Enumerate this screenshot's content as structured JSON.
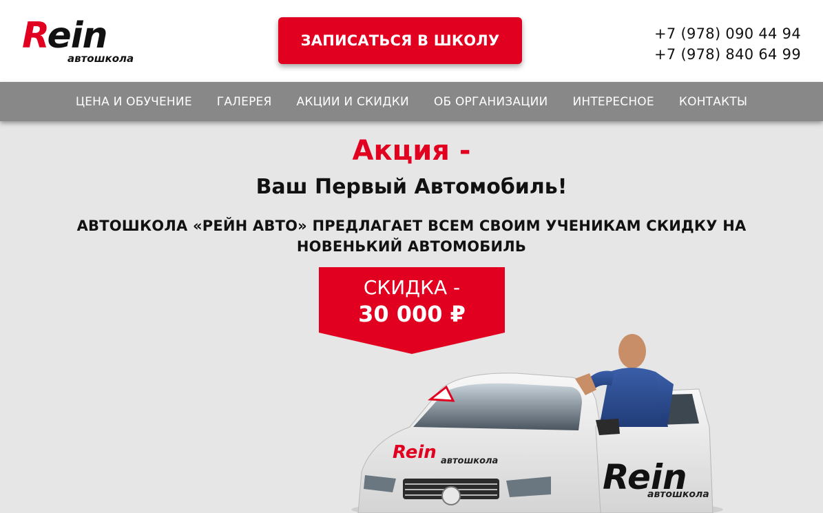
{
  "header": {
    "logo": {
      "brand": "Rein",
      "brand_first": "R",
      "brand_rest": "ein",
      "subtitle": "автошкола"
    },
    "cta_label": "ЗАПИСАТЬСЯ В ШКОЛУ",
    "phones": [
      "+7 (978) 090 44 94",
      "+7 (978) 840 64 99"
    ]
  },
  "nav": {
    "items": [
      {
        "label": "ЦЕНА И ОБУЧЕНИЕ"
      },
      {
        "label": "ГАЛЕРЕЯ"
      },
      {
        "label": "АКЦИИ И СКИДКИ"
      },
      {
        "label": "ОБ ОРГАНИЗАЦИИ"
      },
      {
        "label": "ИНТЕРЕСНОЕ"
      },
      {
        "label": "КОНТАКТЫ"
      }
    ]
  },
  "promo": {
    "title": "Акция -",
    "subtitle": "Ваш Первый Автомобиль!",
    "description": "АВТОШКОЛА «РЕЙН АВТО» ПРЕДЛАГАЕТ ВСЕМ СВОИМ УЧЕНИКАМ СКИДКУ НА НОВЕНЬКИЙ АВТОМОБИЛЬ",
    "discount_label": "СКИДКА -",
    "discount_value": "30 000 ₽"
  },
  "photo": {
    "car_logo_brand": "Rein",
    "car_logo_subtitle": "автошкола",
    "door_logo_brand": "Rein",
    "door_logo_subtitle": "автошкола"
  },
  "colors": {
    "accent": "#e1001f",
    "nav_bg": "#888888",
    "page_bg": "#e6e6e6",
    "header_bg": "#ffffff"
  }
}
